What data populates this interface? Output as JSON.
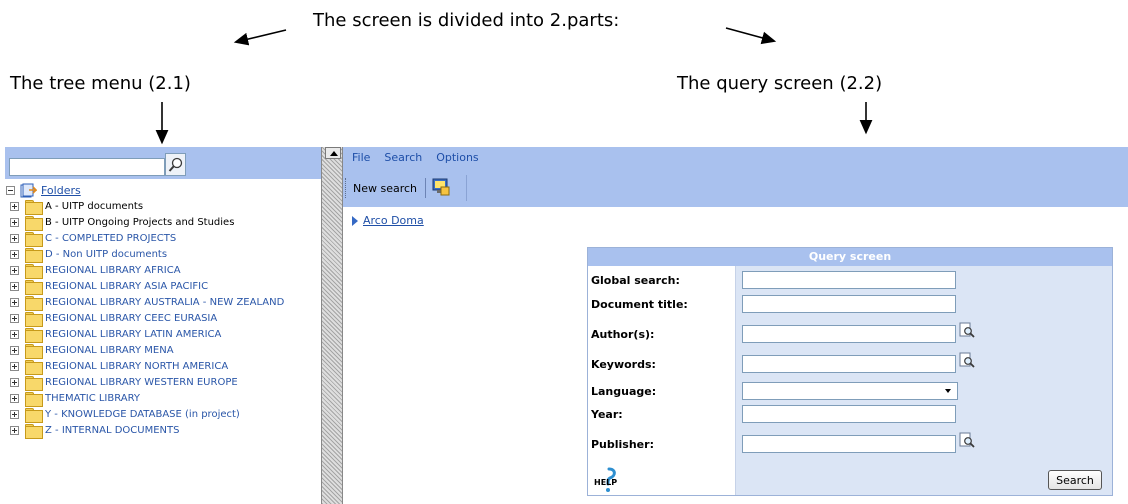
{
  "annotations": {
    "top": "The screen is divided into 2.parts:",
    "left": "The tree menu (2.1)",
    "right": "The query screen (2.2)"
  },
  "tree": {
    "search_value": "",
    "root_label": "Folders",
    "items": [
      {
        "label": "A - UITP documents",
        "color": "#000000"
      },
      {
        "label": "B - UITP Ongoing Projects and Studies",
        "color": "#000000"
      },
      {
        "label": "C - COMPLETED PROJECTS",
        "color": "#2a56a8"
      },
      {
        "label": "D - Non UITP documents",
        "color": "#2a56a8"
      },
      {
        "label": "REGIONAL LIBRARY AFRICA",
        "color": "#2a56a8"
      },
      {
        "label": "REGIONAL LIBRARY ASIA PACIFIC",
        "color": "#2a56a8"
      },
      {
        "label": "REGIONAL LIBRARY AUSTRALIA - NEW ZEALAND",
        "color": "#2a56a8"
      },
      {
        "label": "REGIONAL LIBRARY CEEC EURASIA",
        "color": "#2a56a8"
      },
      {
        "label": "REGIONAL LIBRARY LATIN AMERICA",
        "color": "#2a56a8"
      },
      {
        "label": "REGIONAL LIBRARY MENA",
        "color": "#2a56a8"
      },
      {
        "label": "REGIONAL LIBRARY NORTH AMERICA",
        "color": "#2a56a8"
      },
      {
        "label": "REGIONAL LIBRARY WESTERN EUROPE",
        "color": "#2a56a8"
      },
      {
        "label": "THEMATIC LIBRARY",
        "color": "#2a56a8"
      },
      {
        "label": "Y - KNOWLEDGE DATABASE (in project)",
        "color": "#2a56a8"
      },
      {
        "label": "Z - INTERNAL DOCUMENTS",
        "color": "#2a56a8"
      }
    ]
  },
  "menu": {
    "file": "File",
    "search": "Search",
    "options": "Options"
  },
  "toolbar": {
    "new_search": "New search"
  },
  "breadcrumb": {
    "link": "Arco Doma"
  },
  "query": {
    "title": "Query screen",
    "global_search": "Global search:",
    "document_title": "Document title:",
    "authors": "Author(s):",
    "keywords": "Keywords:",
    "language": "Language:",
    "year": "Year:",
    "publisher": "Publisher:",
    "help_text": "HELP",
    "search_button": "Search",
    "values": {
      "global_search": "",
      "document_title": "",
      "authors": "",
      "keywords": "",
      "year": "",
      "publisher": ""
    }
  },
  "colors": {
    "header_blue": "#a9c1ee",
    "field_panel": "#dbe5f5",
    "link_blue": "#1f4fa7"
  }
}
